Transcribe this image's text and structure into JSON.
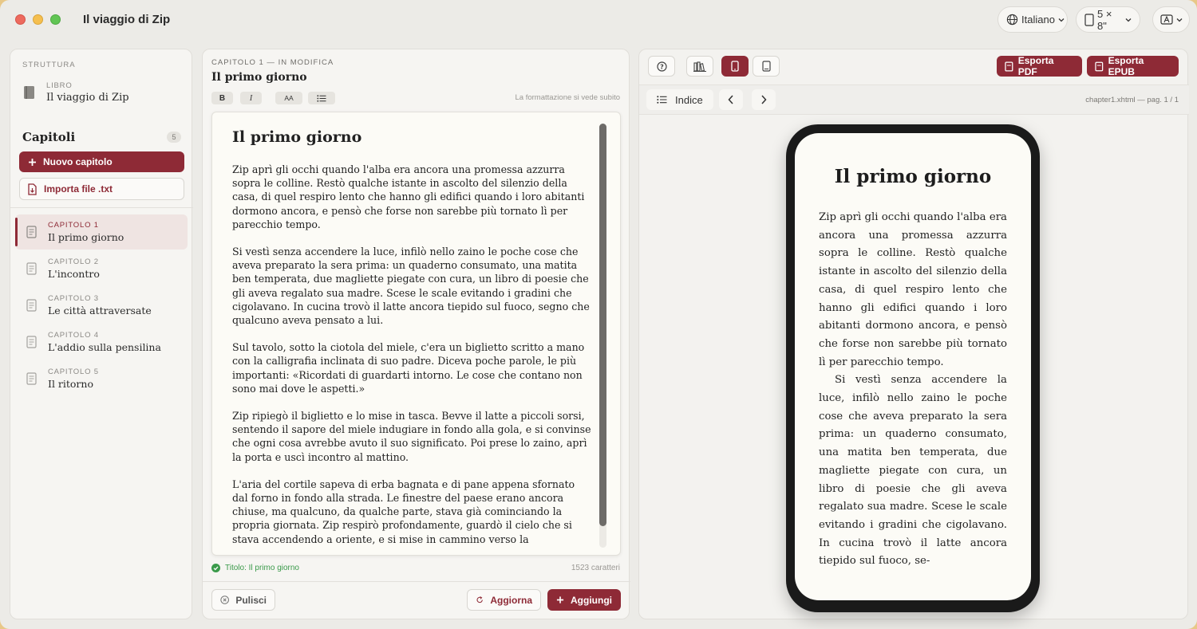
{
  "window": {
    "title": "Il viaggio di Zip"
  },
  "toolbar": {
    "language": "Italiano",
    "size": "5 × 8\""
  },
  "sidebar": {
    "heading": "STRUTTURA",
    "book_label": "LIBRO",
    "book_title": "Il viaggio di Zip",
    "chapters_heading": "Capitoli",
    "chapters_count": "5",
    "new_chapter": "Nuovo capitolo",
    "import_file": "Importa file .txt",
    "chapters": [
      {
        "num": "CAPITOLO 1",
        "title": "Il primo giorno"
      },
      {
        "num": "CAPITOLO 2",
        "title": "L'incontro"
      },
      {
        "num": "CAPITOLO 3",
        "title": "Le città attraversate"
      },
      {
        "num": "CAPITOLO 4",
        "title": "L'addio sulla pensilina"
      },
      {
        "num": "CAPITOLO 5",
        "title": "Il ritorno"
      }
    ]
  },
  "editor": {
    "subtitle": "CAPITOLO 1 — IN MODIFICA",
    "title": "Il primo giorno",
    "fmt_bold": "B",
    "fmt_italic": "I",
    "fmt_size": "AA",
    "format_hint": "La formattazione si vede subito",
    "doc_title": "Il primo giorno",
    "paragraphs": [
      "Zip aprì gli occhi quando l'alba era ancora una promessa azzurra sopra le colline. Restò qualche istante in ascolto del silenzio della casa, di quel respiro lento che hanno gli edifici quando i loro abitanti dormono ancora, e pensò che forse non sarebbe più tornato lì per parecchio tempo.",
      "Si vestì senza accendere la luce, infilò nello zaino le poche cose che aveva preparato la sera prima: un quaderno consumato, una matita ben temperata, due magliette piegate con cura, un libro di poesie che gli aveva regalato sua madre. Scese le scale evitando i gradini che cigolavano. In cucina trovò il latte ancora tiepido sul fuoco, segno che qualcuno aveva pensato a lui.",
      "Sul tavolo, sotto la ciotola del miele, c'era un biglietto scritto a mano con la calligrafia inclinata di suo padre. Diceva poche parole, le più importanti: «Ricordati di guardarti intorno. Le cose che contano non sono mai dove le aspetti.»",
      "Zip ripiegò il biglietto e lo mise in tasca. Bevve il latte a piccoli sorsi, sentendo il sapore del miele indugiare in fondo alla gola, e si convinse che ogni cosa avrebbe avuto il suo significato. Poi prese lo zaino, aprì la porta e uscì incontro al mattino.",
      "L'aria del cortile sapeva di erba bagnata e di pane appena sfornato dal forno in fondo alla strada. Le finestre del paese erano ancora chiuse, ma qualcuno, da qualche parte, stava già cominciando la propria giornata. Zip respirò profondamente, guardò il cielo che si stava accendendo a oriente, e si mise in cammino verso la"
    ],
    "status": "Titolo: Il primo giorno",
    "char_count": "1523 caratteri",
    "clear": "Pulisci",
    "update": "Aggiorna",
    "add": "Aggiungi"
  },
  "preview": {
    "export_pdf": "Esporta PDF",
    "export_epub": "Esporta EPUB",
    "index": "Indice",
    "page_info": "chapter1.xhtml — pag. 1 / 1",
    "screen_title": "Il primo giorno",
    "screen_paragraphs": [
      "Zip aprì gli occhi quando l'alba era ancora una promessa azzurra sopra le colline. Restò qualche istante in ascolto del silenzio della casa, di quel respiro lento che hanno gli edifici quando i loro abitanti dormono ancora, e pensò che forse non sarebbe più tornato lì per parecchio tempo.",
      "Si vestì senza accendere la luce, infilò nello zaino le poche cose che aveva preparato la sera prima: un quaderno consumato, una matita ben temperata, due magliette piegate con cura, un libro di poesie che gli aveva regalato sua madre. Scese le scale evitando i gradini che cigolavano. In cucina trovò il latte ancora tiepido sul fuoco, se-"
    ]
  },
  "colors": {
    "accent": "#8e2a36",
    "success": "#3a9a4a"
  }
}
